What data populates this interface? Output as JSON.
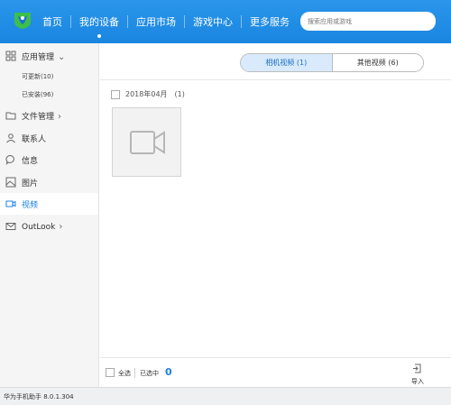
{
  "header": {
    "nav": [
      {
        "label": "首页"
      },
      {
        "label": "我的设备"
      },
      {
        "label": "应用市场"
      },
      {
        "label": "游戏中心"
      },
      {
        "label": "更多服务"
      }
    ],
    "search_placeholder": "搜索应用或游戏"
  },
  "sidebar": {
    "app_manage": "应用管理",
    "updatable": "可更新(10)",
    "installed": "已安装(96)",
    "file_manage": "文件管理",
    "contacts": "联系人",
    "messages": "信息",
    "pictures": "图片",
    "videos": "视频",
    "outlook": "OutLook"
  },
  "main": {
    "tabs": [
      {
        "label": "相机视频 (1)"
      },
      {
        "label": "其他视频 (6)"
      }
    ],
    "group": {
      "date": "2018年04月",
      "count": "(1)"
    }
  },
  "bottom": {
    "select_all": "全选",
    "selected_label": "已选中",
    "selected_count": "0",
    "import": "导入"
  },
  "status": {
    "text": "华为手机助手 8.0.1.304"
  },
  "colors": {
    "header": "#1a86e0",
    "accent": "#1d80e2",
    "tab_active": "#d8eafb"
  }
}
